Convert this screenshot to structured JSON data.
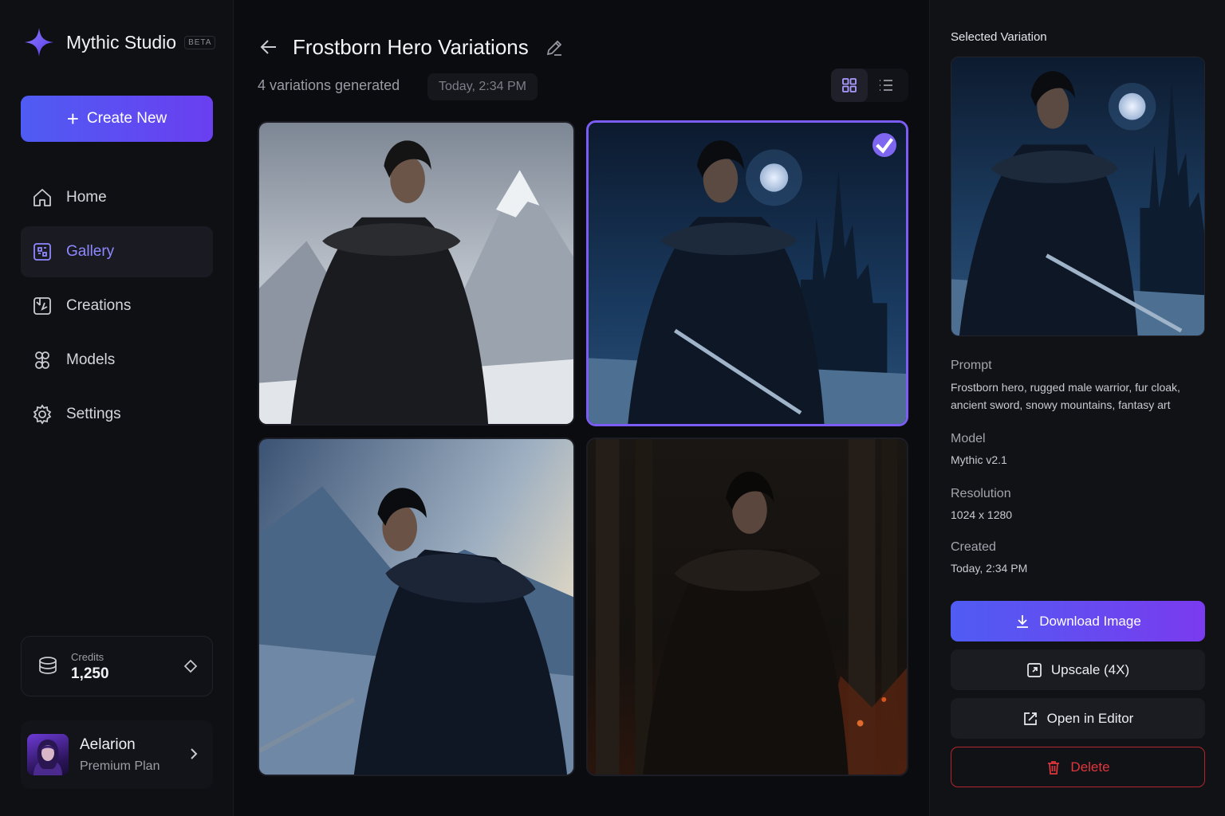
{
  "app": {
    "name": "Mythic Studio",
    "badge": "BETA"
  },
  "sidebar": {
    "create_label": "Create New",
    "items": [
      {
        "label": "Home",
        "icon": "home-icon",
        "active": false
      },
      {
        "label": "Gallery",
        "icon": "gallery-icon",
        "active": true
      },
      {
        "label": "Creations",
        "icon": "creations-icon",
        "active": false
      },
      {
        "label": "Models",
        "icon": "models-icon",
        "active": false
      },
      {
        "label": "Settings",
        "icon": "gear-icon",
        "active": false
      }
    ],
    "credits": {
      "label": "Credits",
      "value": "1,250"
    },
    "user": {
      "name": "Aelarion",
      "plan": "Premium Plan"
    }
  },
  "main": {
    "title": "Frostborn Hero Variations",
    "subtitle": "4 variations generated",
    "date": "Today, 2:34 PM",
    "view_mode": "grid",
    "variations": [
      {
        "scene": "snowy mountains",
        "selected": false
      },
      {
        "scene": "moonlit castle",
        "selected": true
      },
      {
        "scene": "dawn snowfield",
        "selected": false
      },
      {
        "scene": "ember forest",
        "selected": false
      }
    ]
  },
  "panel": {
    "title": "Selected Variation",
    "prompt_label": "Prompt",
    "prompt": "Frostborn hero, rugged male warrior, fur cloak, ancient sword, snowy mountains, fantasy art",
    "model_label": "Model",
    "model": "Mythic v2.1",
    "resolution_label": "Resolution",
    "resolution": "1024 x 1280",
    "created_label": "Created",
    "created": "Today, 2:34 PM",
    "download_label": "Download Image",
    "upscale_label": "Upscale (4X)",
    "editor_label": "Open in Editor",
    "delete_label": "Delete"
  },
  "colors": {
    "accent": "#7b5cf5",
    "primary_gradient_start": "#4f5cf3",
    "primary_gradient_end": "#7a3bee",
    "danger": "#e0363d",
    "background": "#0b0c10"
  }
}
